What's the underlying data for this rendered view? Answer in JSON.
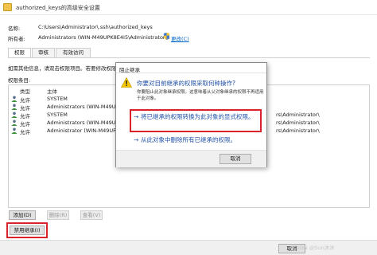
{
  "window": {
    "title": "authorized_keys的高级安全设置"
  },
  "properties": {
    "name_label": "名称:",
    "name_value": "C:\\Users\\Administrator\\.ssh\\authorized_keys",
    "owner_label": "所有者:",
    "owner_value": "Administrators (WIN-M49UPK8E4I5\\Administrators)",
    "change_link": "更改(C)"
  },
  "tabs": [
    {
      "label": "权限",
      "active": true
    },
    {
      "label": "审核",
      "active": false
    },
    {
      "label": "有效访问",
      "active": false
    }
  ],
  "info_text": "如需其他信息，请双击权限项目。若要修改权限项目，",
  "entries_title": "权限条目:",
  "table": {
    "headers": [
      "类型",
      "主体"
    ],
    "rows": [
      {
        "type": "允许",
        "principal": "SYSTEM",
        "tail": ""
      },
      {
        "type": "允许",
        "principal": "Administrators (WIN-M49UPK8E",
        "tail": ""
      },
      {
        "type": "允许",
        "principal": "SYSTEM",
        "tail": "rs\\Administrator\\"
      },
      {
        "type": "允许",
        "principal": "Administrators (WIN-M49UPK8E",
        "tail": "rs\\Administrator\\"
      },
      {
        "type": "允许",
        "principal": "Administrator (WIN-M49UPK8E4",
        "tail": "rs\\Administrator\\"
      }
    ]
  },
  "buttons": {
    "add": "添加(D)",
    "remove": "删除(R)",
    "view": "查看(V)",
    "disable_inheritance": "禁用继承(I)"
  },
  "dialog": {
    "title": "阻止继承",
    "question": "你要对目前继承的权限采取何种操作?",
    "description": "你要阻止此对象继承权限。这意味着从父对象继承的权限不再适用于此对象。",
    "option_convert": "将已继承的权限转换为此对象的显式权限。",
    "option_remove": "从此对象中删除所有已继承的权限。",
    "cancel": "取消",
    "arrow": "→"
  },
  "bottom": {
    "cancel": "取消",
    "watermark": "CSDN @Sun沐沐"
  },
  "colors": {
    "accent_blue": "#1f4fa8",
    "highlight_red": "#d8232a",
    "link_blue": "#0066cc"
  },
  "icons": [
    "folder-icon",
    "shield-icon",
    "user-icon",
    "warning-icon"
  ]
}
